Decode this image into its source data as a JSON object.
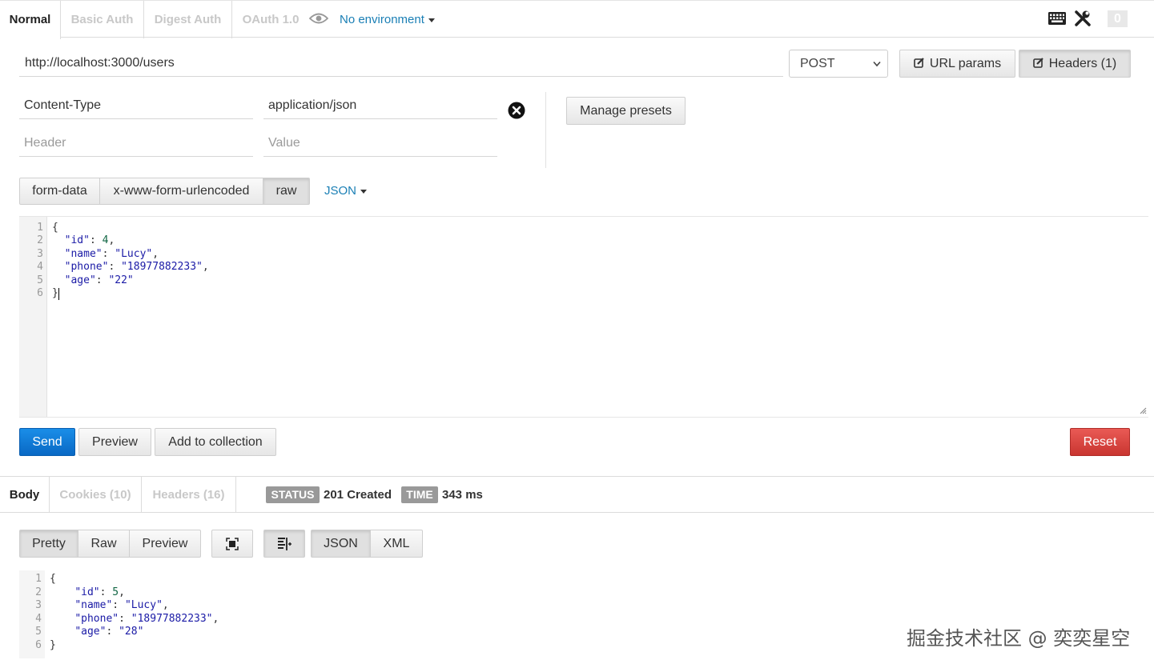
{
  "top_tabs": [
    "Normal",
    "Basic Auth",
    "Digest Auth",
    "OAuth 1.0"
  ],
  "environment": {
    "label": "No environment"
  },
  "notifications": {
    "count": "0"
  },
  "request": {
    "url": "http://localhost:3000/users",
    "method": "POST",
    "url_params_label": "URL params",
    "headers_label": "Headers (1)"
  },
  "headers_editor": {
    "rows": [
      {
        "key": "Content-Type",
        "value": "application/json"
      }
    ],
    "key_placeholder": "Header",
    "value_placeholder": "Value",
    "manage_presets_label": "Manage presets"
  },
  "body_types": [
    "form-data",
    "x-www-form-urlencoded",
    "raw"
  ],
  "body_format": "JSON",
  "request_body_lines": [
    {
      "num": "1",
      "text": "{"
    },
    {
      "num": "2",
      "text": "  \"id\": 4,"
    },
    {
      "num": "3",
      "text": "  \"name\": \"Lucy\","
    },
    {
      "num": "4",
      "text": "  \"phone\": \"18977882233\","
    },
    {
      "num": "5",
      "text": "  \"age\": \"22\""
    },
    {
      "num": "6",
      "text": "}"
    }
  ],
  "actions": {
    "send": "Send",
    "preview": "Preview",
    "add_to_collection": "Add to collection",
    "reset": "Reset"
  },
  "response_tabs": [
    "Body",
    "Cookies (10)",
    "Headers (16)"
  ],
  "status": {
    "label": "STATUS",
    "value": "201 Created"
  },
  "time": {
    "label": "TIME",
    "value": "343 ms"
  },
  "response_views": [
    "Pretty",
    "Raw",
    "Preview"
  ],
  "response_formats": [
    "JSON",
    "XML"
  ],
  "response_body_lines": [
    {
      "num": "1",
      "text": "{"
    },
    {
      "num": "2",
      "text": "    \"id\": 5,"
    },
    {
      "num": "3",
      "text": "    \"name\": \"Lucy\","
    },
    {
      "num": "4",
      "text": "    \"phone\": \"18977882233\","
    },
    {
      "num": "5",
      "text": "    \"age\": \"28\""
    },
    {
      "num": "6",
      "text": "}"
    }
  ],
  "watermark": "掘金技术社区 @ 奕奕星空",
  "colors": {
    "accent": "#1a7fb5",
    "send": "#0d6fd0",
    "reset": "#d9413c"
  }
}
